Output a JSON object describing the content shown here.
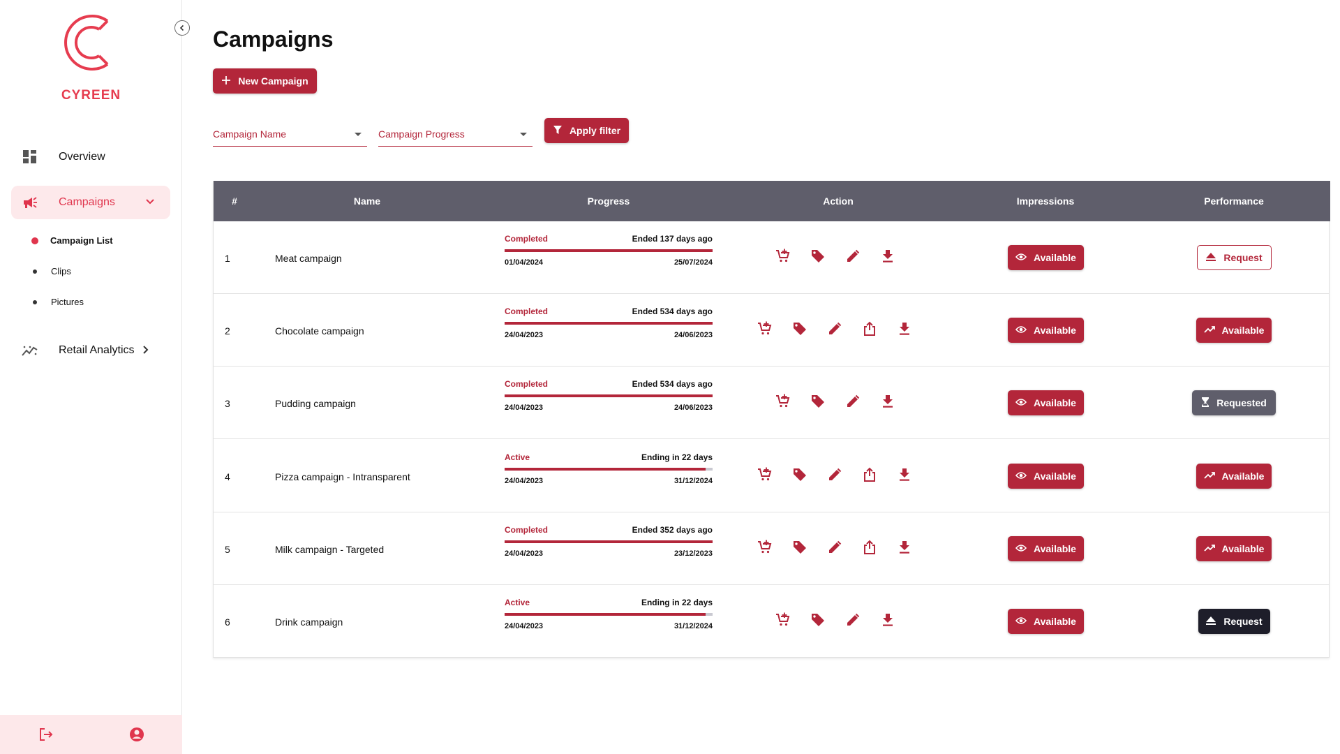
{
  "sidebar": {
    "brand": "CYREEN",
    "nav": {
      "overview": "Overview",
      "campaigns": "Campaigns",
      "retail_analytics": "Retail Analytics"
    },
    "sub_items": [
      "Campaign List",
      "Clips",
      "Pictures"
    ]
  },
  "main": {
    "title": "Campaigns",
    "new_campaign": "New Campaign",
    "filters": {
      "campaign_name": "Campaign Name",
      "campaign_progress": "Campaign Progress",
      "apply": "Apply filter"
    }
  },
  "table": {
    "headers": [
      "#",
      "Name",
      "Progress",
      "Action",
      "Impressions",
      "Performance"
    ],
    "rows": [
      {
        "num": "1",
        "name": "Meat campaign",
        "status": "Completed",
        "ended": "Ended 137 days ago",
        "start": "01/04/2024",
        "end": "25/07/2024",
        "progress": 1.0,
        "actions": [
          "cart-icon",
          "tag-icon",
          "edit-icon",
          "download-icon"
        ],
        "impressions": "Available",
        "performance": "Request",
        "performance_style": "outline"
      },
      {
        "num": "2",
        "name": "Chocolate campaign",
        "status": "Completed",
        "ended": "Ended 534 days ago",
        "start": "24/04/2023",
        "end": "24/06/2023",
        "progress": 1.0,
        "actions": [
          "cart-icon",
          "tag-icon",
          "edit-icon",
          "share-icon",
          "download-icon"
        ],
        "impressions": "Available",
        "performance": "Available",
        "performance_style": "red"
      },
      {
        "num": "3",
        "name": "Pudding campaign",
        "status": "Completed",
        "ended": "Ended 534 days ago",
        "start": "24/04/2023",
        "end": "24/06/2023",
        "progress": 1.0,
        "actions": [
          "cart-icon",
          "tag-icon",
          "edit-icon",
          "download-icon"
        ],
        "impressions": "Available",
        "performance": "Requested",
        "performance_style": "grey"
      },
      {
        "num": "4",
        "name": "Pizza campaign - Intransparent",
        "status": "Active",
        "ended": "Ending in 22 days",
        "start": "24/04/2023",
        "end": "31/12/2024",
        "progress": 0.965,
        "actions": [
          "cart-icon",
          "tag-icon",
          "edit-icon",
          "share-icon",
          "download-icon"
        ],
        "impressions": "Available",
        "performance": "Available",
        "performance_style": "red"
      },
      {
        "num": "5",
        "name": "Milk campaign - Targeted",
        "status": "Completed",
        "ended": "Ended 352 days ago",
        "start": "24/04/2023",
        "end": "23/12/2023",
        "progress": 1.0,
        "actions": [
          "cart-icon",
          "tag-icon",
          "edit-icon",
          "share-icon",
          "download-icon"
        ],
        "impressions": "Available",
        "performance": "Available",
        "performance_style": "red"
      },
      {
        "num": "6",
        "name": "Drink campaign",
        "status": "Active",
        "ended": "Ending in 22 days",
        "start": "24/04/2023",
        "end": "31/12/2024",
        "progress": 0.965,
        "actions": [
          "cart-icon",
          "tag-icon",
          "edit-icon",
          "download-icon"
        ],
        "impressions": "Available",
        "performance": "Request",
        "performance_style": "dark"
      }
    ]
  },
  "colors": {
    "accent": "#b3263a",
    "brand": "#e63c4f",
    "header_bg": "#5f5e6b",
    "active_nav_bg": "#fde9eb"
  }
}
